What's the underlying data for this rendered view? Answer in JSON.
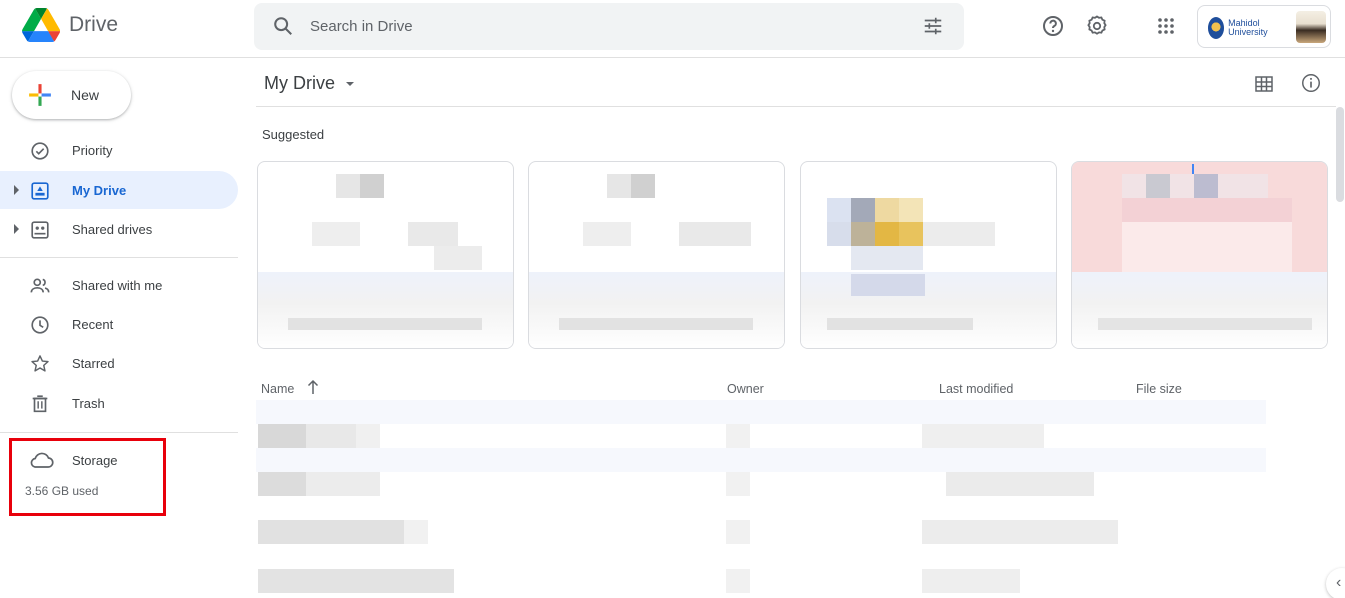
{
  "header": {
    "app_name": "Drive",
    "search_placeholder": "Search in Drive",
    "account_org": "Mahidol University"
  },
  "sidebar": {
    "new_label": "New",
    "items": [
      {
        "label": "Priority",
        "icon": "priority-icon"
      },
      {
        "label": "My Drive",
        "icon": "my-drive-icon",
        "active": true
      },
      {
        "label": "Shared drives",
        "icon": "shared-drives-icon"
      },
      {
        "label": "Shared with me",
        "icon": "people-icon"
      },
      {
        "label": "Recent",
        "icon": "clock-icon"
      },
      {
        "label": "Starred",
        "icon": "star-icon"
      },
      {
        "label": "Trash",
        "icon": "trash-icon"
      }
    ],
    "storage": {
      "label": "Storage",
      "used": "3.56 GB used"
    }
  },
  "main": {
    "title": "My Drive",
    "suggested_label": "Suggested",
    "columns": [
      "Name",
      "Owner",
      "Last modified",
      "File size"
    ]
  },
  "colors": {
    "accent": "#1967d2",
    "active_bg": "#e8f0fe",
    "highlight_box": "#e8000b"
  }
}
